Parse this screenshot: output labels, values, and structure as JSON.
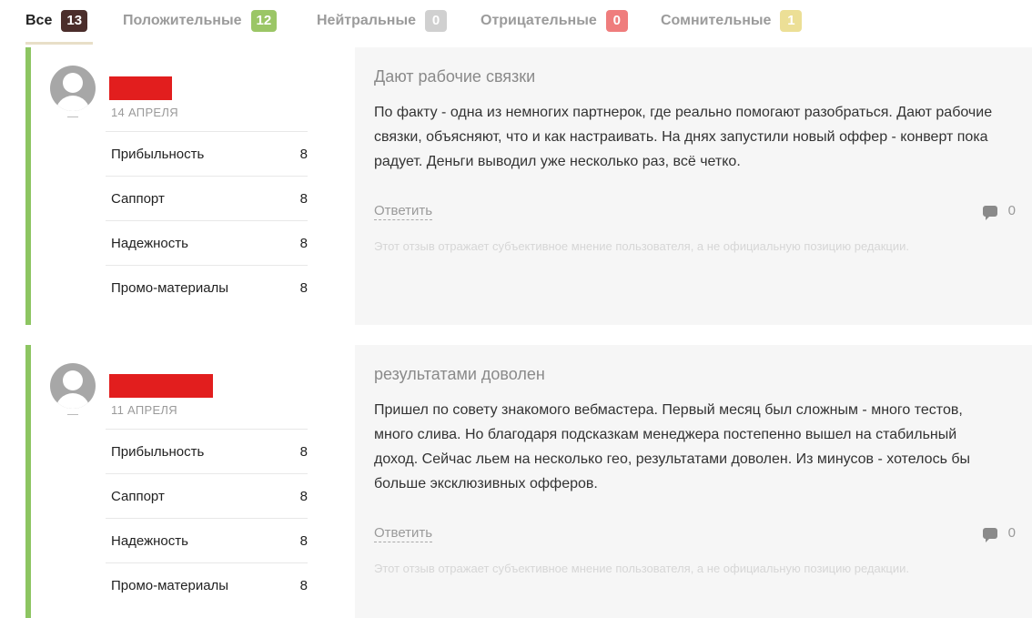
{
  "tabs": [
    {
      "label": "Все",
      "count": "13",
      "color": "#4b2e2b",
      "active": true
    },
    {
      "label": "Положительные",
      "count": "12",
      "color": "#9bc666"
    },
    {
      "label": "Нейтральные",
      "count": "0",
      "color": "#d0d0d0"
    },
    {
      "label": "Отрицательные",
      "count": "0",
      "color": "#ef7d7d"
    },
    {
      "label": "Сомнительные",
      "count": "1",
      "color": "#ecdf96"
    }
  ],
  "colors": {
    "accent_positive": "#8dc562",
    "redaction": "#e21e1e",
    "panel_bg": "#f6f6f6"
  },
  "reviews": [
    {
      "date": "14 АПРЕЛЯ",
      "ratings": [
        {
          "label": "Прибыльность",
          "value": "8"
        },
        {
          "label": "Саппорт",
          "value": "8"
        },
        {
          "label": "Надежность",
          "value": "8"
        },
        {
          "label": "Промо-материалы",
          "value": "8"
        }
      ],
      "title": "Дают рабочие связки",
      "text": "По факту - одна из немногих партнерок, где реально помогают разобраться. Дают рабочие связки, объясняют, что и как настраивать. На днях запустили новый оффер - конверт пока радует. Деньги выводил уже несколько раз, всё четко.",
      "reply_label": "Ответить",
      "comments_count": "0",
      "disclaimer": "Этот отзыв отражает субъективное мнение пользователя, а не официальную позицию редакции."
    },
    {
      "date": "11 АПРЕЛЯ",
      "ratings": [
        {
          "label": "Прибыльность",
          "value": "8"
        },
        {
          "label": "Саппорт",
          "value": "8"
        },
        {
          "label": "Надежность",
          "value": "8"
        },
        {
          "label": "Промо-материалы",
          "value": "8"
        }
      ],
      "title": "результатами доволен",
      "text": "Пришел по совету знакомого вебмастера. Первый месяц был сложным - много тестов, много слива. Но благодаря подсказкам менеджера постепенно вышел на стабильный доход. Сейчас льем на несколько гео, результатами доволен. Из минусов - хотелось бы больше эксклюзивных офферов.",
      "reply_label": "Ответить",
      "comments_count": "0",
      "disclaimer": "Этот отзыв отражает субъективное мнение пользователя, а не официальную позицию редакции."
    }
  ]
}
